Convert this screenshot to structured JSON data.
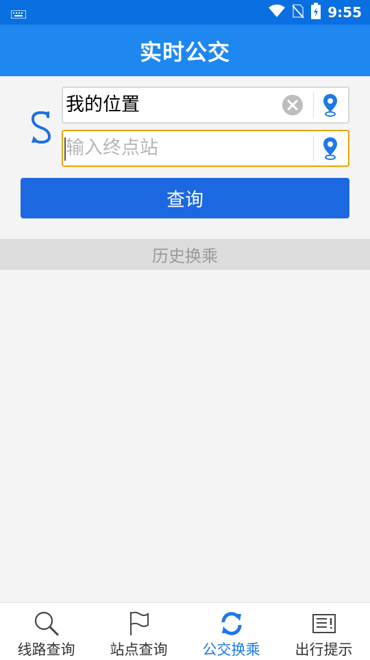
{
  "status_bar": {
    "time": "9:55"
  },
  "header": {
    "title": "实时公交"
  },
  "form": {
    "start_value": "我的位置",
    "end_placeholder": "输入终点站",
    "query_label": "查询"
  },
  "history": {
    "label": "历史换乘"
  },
  "bottom_nav": {
    "items": [
      {
        "label": "线路查询",
        "icon": "search-icon"
      },
      {
        "label": "站点查询",
        "icon": "flag-icon"
      },
      {
        "label": "公交换乘",
        "icon": "swap-icon",
        "active": true
      },
      {
        "label": "出行提示",
        "icon": "notice-icon"
      }
    ]
  },
  "colors": {
    "accent": "#1e88f0",
    "button": "#1c68e0",
    "active_nav": "#1e78e8",
    "focus_border": "#e8a400"
  }
}
